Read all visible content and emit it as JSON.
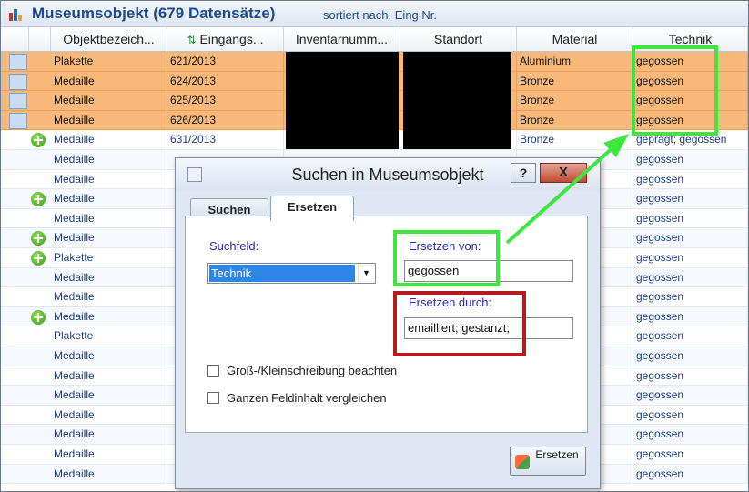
{
  "window": {
    "title": "Museumsobjekt (679 Datensätze)",
    "sort_info": "sortiert nach: Eing.Nr."
  },
  "grid": {
    "columns": [
      {
        "label": "Objektbezeich..."
      },
      {
        "label": "Eingangs..."
      },
      {
        "label": "Inventarnumm..."
      },
      {
        "label": "Standort"
      },
      {
        "label": "Material"
      },
      {
        "label": "Technik"
      }
    ],
    "rows": [
      {
        "objekt": "Plakette",
        "eingang": "621/2013",
        "material": "Aluminium",
        "technik": "gegossen",
        "selected": true,
        "plus": false
      },
      {
        "objekt": "Medaille",
        "eingang": "624/2013",
        "material": "Bronze",
        "technik": "gegossen",
        "selected": true,
        "plus": false
      },
      {
        "objekt": "Medaille",
        "eingang": "625/2013",
        "material": "Bronze",
        "technik": "gegossen",
        "selected": true,
        "plus": false
      },
      {
        "objekt": "Medaille",
        "eingang": "626/2013",
        "material": "Bronze",
        "technik": "gegossen",
        "selected": true,
        "plus": false
      },
      {
        "objekt": "Medaille",
        "eingang": "631/2013",
        "material": "Bronze",
        "technik": "geprägt; gegossen",
        "selected": false,
        "plus": true
      },
      {
        "objekt": "Medaille",
        "eingang": "",
        "material": "",
        "technik": "gegossen",
        "selected": false,
        "plus": false
      },
      {
        "objekt": "Medaille",
        "eingang": "",
        "material": "",
        "technik": "gegossen",
        "selected": false,
        "plus": false
      },
      {
        "objekt": "Medaille",
        "eingang": "",
        "material": "",
        "technik": "gegossen",
        "selected": false,
        "plus": true
      },
      {
        "objekt": "Medaille",
        "eingang": "",
        "material": "",
        "technik": "gegossen",
        "selected": false,
        "plus": false
      },
      {
        "objekt": "Medaille",
        "eingang": "",
        "material": "",
        "technik": "gegossen",
        "selected": false,
        "plus": true
      },
      {
        "objekt": "Plakette",
        "eingang": "",
        "material": "",
        "technik": "gegossen",
        "selected": false,
        "plus": true
      },
      {
        "objekt": "Medaille",
        "eingang": "",
        "material": "",
        "technik": "gegossen",
        "selected": false,
        "plus": false
      },
      {
        "objekt": "Medaille",
        "eingang": "",
        "material": "",
        "technik": "gegossen",
        "selected": false,
        "plus": false
      },
      {
        "objekt": "Medaille",
        "eingang": "",
        "material": "",
        "technik": "gegossen",
        "selected": false,
        "plus": true
      },
      {
        "objekt": "Plakette",
        "eingang": "",
        "material": "",
        "technik": "gegossen",
        "selected": false,
        "plus": false
      },
      {
        "objekt": "Medaille",
        "eingang": "",
        "material": "",
        "technik": "gegossen",
        "selected": false,
        "plus": false
      },
      {
        "objekt": "Medaille",
        "eingang": "",
        "material": "",
        "technik": "gegossen",
        "selected": false,
        "plus": false
      },
      {
        "objekt": "Medaille",
        "eingang": "",
        "material": "",
        "technik": "gegossen",
        "selected": false,
        "plus": false
      },
      {
        "objekt": "Medaille",
        "eingang": "",
        "material": "",
        "technik": "gegossen",
        "selected": false,
        "plus": false
      },
      {
        "objekt": "Medaille",
        "eingang": "",
        "material": "",
        "technik": "gegossen",
        "selected": false,
        "plus": false
      },
      {
        "objekt": "Medaille",
        "eingang": "",
        "material": "",
        "technik": "gegossen",
        "selected": false,
        "plus": false
      },
      {
        "objekt": "Medaille",
        "eingang": "",
        "material": "",
        "technik": "gegossen",
        "selected": false,
        "plus": false
      }
    ]
  },
  "dialog": {
    "title": "Suchen in Museumsobjekt",
    "help_label": "?",
    "close_label": "X",
    "tabs": {
      "suchen": "Suchen",
      "ersetzen": "Ersetzen"
    },
    "suchfeld_label": "Suchfeld:",
    "suchfeld_value": "Technik",
    "ersetzen_von_label": "Ersetzen von:",
    "ersetzen_von_value": "gegossen",
    "ersetzen_durch_label": "Ersetzen durch:",
    "ersetzen_durch_value": "emailliert; gestanzt;",
    "checkbox_case_label": "Groß-/Kleinschreibung beachten",
    "checkbox_whole_label": "Ganzen Feldinhalt vergleichen",
    "replace_button_label": "Ersetzen"
  },
  "colors": {
    "selected_row": "#f7b87a",
    "highlight_green": "#3fe63f",
    "highlight_red": "#b21c1c",
    "title_blue": "#1d4a8c"
  }
}
